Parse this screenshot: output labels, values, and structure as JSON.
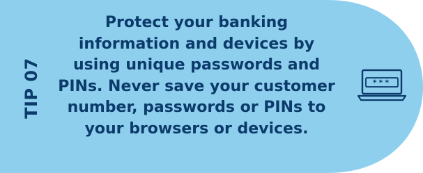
{
  "tip": {
    "label": "TIP 07",
    "lines": [
      "Protect your banking",
      "information and devices by",
      "using unique passwords and",
      "PINs. Never save your customer",
      "number, passwords or PINs to",
      "your browsers or devices."
    ]
  },
  "icon": {
    "name": "laptop-password-icon",
    "screen_text": "***"
  },
  "colors": {
    "panel": "#8fcfee",
    "text": "#0b3b6b"
  }
}
